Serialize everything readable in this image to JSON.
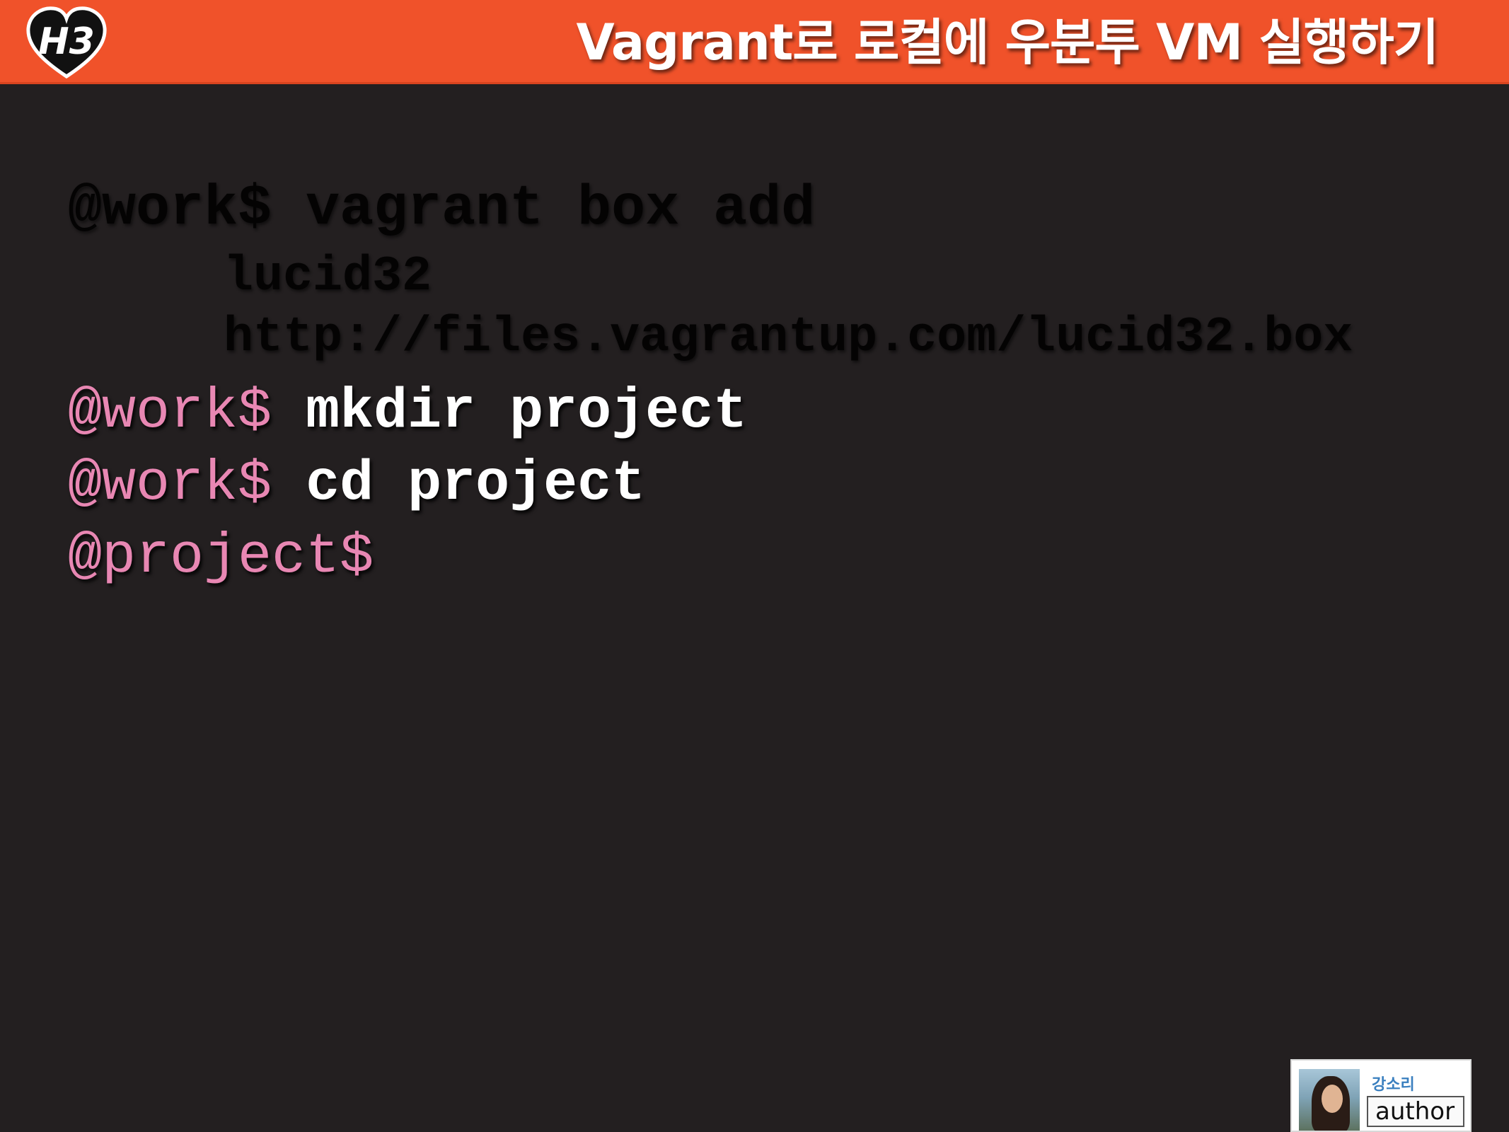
{
  "header": {
    "title": "Vagrant로 로컬에 우분투 VM 실행하기",
    "logo_text": "H3",
    "bg_color": "#f0522a"
  },
  "terminal": {
    "dimmed_line1_prompt": "@work$",
    "dimmed_line1_cmd": "vagrant box add",
    "dimmed_line2": "lucid32",
    "dimmed_line3": "http://files.vagrantup.com/lucid32.box",
    "line4_prompt": "@work$",
    "line4_cmd": "mkdir project",
    "line5_prompt": "@work$",
    "line5_cmd": "cd project",
    "line6_prompt": "@project$"
  },
  "badge": {
    "name": "강소리",
    "role": "author"
  },
  "colors": {
    "background": "#231f20",
    "prompt": "#e887b3",
    "command": "#ffffff"
  }
}
